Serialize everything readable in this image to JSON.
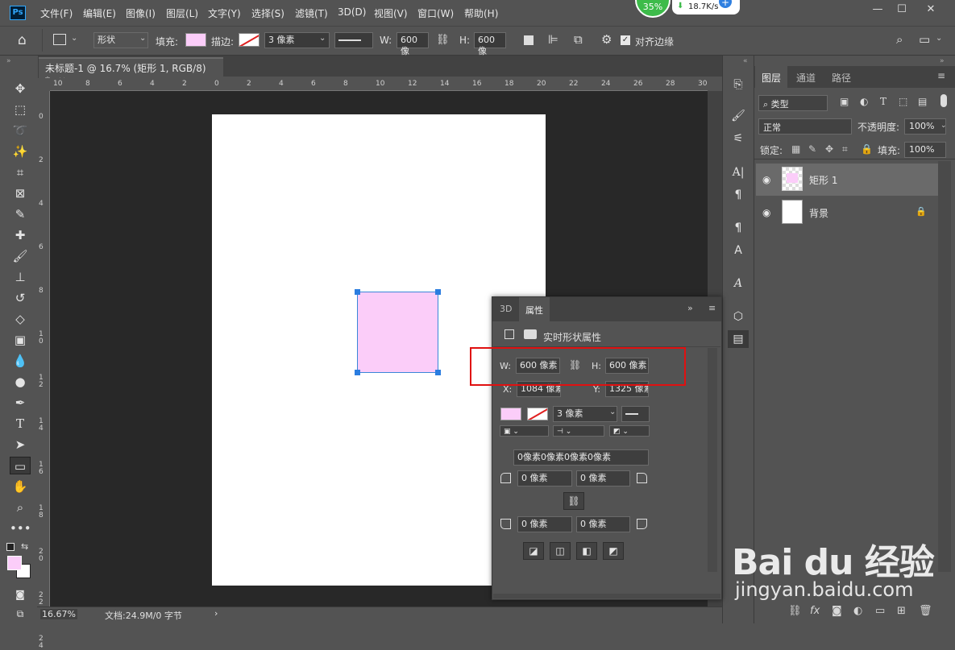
{
  "app": {
    "logo": "Ps"
  },
  "menu": [
    "文件(F)",
    "编辑(E)",
    "图像(I)",
    "图层(L)",
    "文字(Y)",
    "选择(S)",
    "滤镜(T)",
    "3D(D)",
    "视图(V)",
    "窗口(W)",
    "帮助(H)"
  ],
  "net": {
    "percent": "35%",
    "speed": "18.7K/s"
  },
  "options": {
    "mode": "形状",
    "fill_label": "填充:",
    "stroke_label": "描边:",
    "stroke_width": "3 像素",
    "w_label": "W:",
    "w_value": "600 像",
    "h_label": "H:",
    "h_value": "600 像",
    "align_edges": "对齐边缘",
    "fill_color": "#fbcdf9"
  },
  "doc_tab": {
    "title": "未标题-1 @ 16.7% (矩形 1, RGB/8) *",
    "close": "×"
  },
  "ruler_h": [
    "10",
    "8",
    "6",
    "4",
    "2",
    "0",
    "2",
    "4",
    "6",
    "8",
    "10",
    "12",
    "14",
    "16",
    "18",
    "20",
    "22",
    "24",
    "26",
    "28",
    "30"
  ],
  "ruler_v": [
    "0",
    "2",
    "4",
    "6",
    "8",
    "1 0",
    "1 2",
    "1 4",
    "1 6",
    "1 8",
    "2 0",
    "2 2",
    "2 4"
  ],
  "status": {
    "zoom": "16.67%",
    "doc": "文档:24.9M/0 字节",
    "arrow": "›"
  },
  "layers_panel": {
    "tabs": [
      "图层",
      "通道",
      "路径"
    ],
    "filter": "类型",
    "blend": "正常",
    "opacity_label": "不透明度:",
    "opacity": "100%",
    "lock_label": "锁定:",
    "fill_label": "填充:",
    "fill": "100%",
    "layers": [
      {
        "name": "矩形 1",
        "selected": true
      },
      {
        "name": "背景",
        "selected": false
      }
    ]
  },
  "properties": {
    "tabs": [
      "3D",
      "属性"
    ],
    "title": "实时形状属性",
    "w_label": "W:",
    "w": "600 像素",
    "h_label": "H:",
    "h": "600 像素",
    "x_label": "X:",
    "x": "1084 像素",
    "y_label": "Y:",
    "y": "1325 像素",
    "stroke_width": "3 像素",
    "corners_all": "0像素0像素0像素0像素",
    "corner_tl": "0 像素",
    "corner_tr": "0 像素",
    "corner_bl": "0 像素",
    "corner_br": "0 像素"
  },
  "watermark": {
    "main": "Bai du 经验",
    "sub": "jingyan.baidu.com"
  }
}
